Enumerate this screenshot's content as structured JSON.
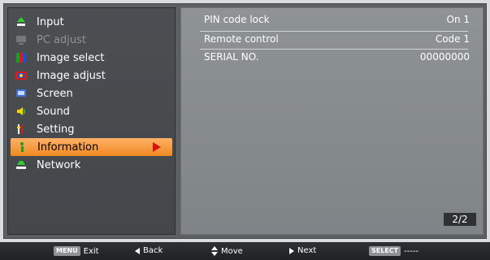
{
  "menu": [
    {
      "label": "Input",
      "icon": "input-icon",
      "disabled": false,
      "selected": false
    },
    {
      "label": "PC adjust",
      "icon": "pc-adjust-icon",
      "disabled": true,
      "selected": false
    },
    {
      "label": "Image select",
      "icon": "image-select-icon",
      "disabled": false,
      "selected": false
    },
    {
      "label": "Image adjust",
      "icon": "image-adjust-icon",
      "disabled": false,
      "selected": false
    },
    {
      "label": "Screen",
      "icon": "screen-icon",
      "disabled": false,
      "selected": false
    },
    {
      "label": "Sound",
      "icon": "sound-icon",
      "disabled": false,
      "selected": false
    },
    {
      "label": "Setting",
      "icon": "setting-icon",
      "disabled": false,
      "selected": false
    },
    {
      "label": "Information",
      "icon": "information-icon",
      "disabled": false,
      "selected": true
    },
    {
      "label": "Network",
      "icon": "network-icon",
      "disabled": false,
      "selected": false
    }
  ],
  "info_rows": [
    {
      "key": "PIN code lock",
      "value": "On 1"
    },
    {
      "key": "Remote control",
      "value": "Code 1"
    },
    {
      "key": "SERIAL NO.",
      "value": "00000000"
    }
  ],
  "page_indicator": "2/2",
  "footer": {
    "exit_key": "MENU",
    "exit_label": "Exit",
    "back_label": "Back",
    "move_label": "Move",
    "next_label": "Next",
    "select_key": "SELECT",
    "select_value": "-----"
  },
  "colors": {
    "selected_bg": "#f08a22",
    "arrow": "#d71414",
    "panel_right": "#878c8f",
    "panel_left": "#46494c"
  }
}
